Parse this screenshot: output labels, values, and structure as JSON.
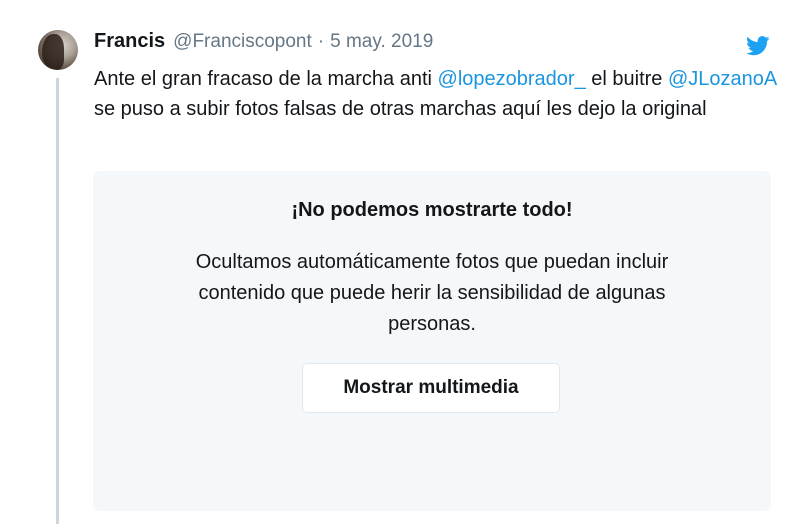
{
  "tweet": {
    "author_name": "Francis",
    "author_handle": "@Franciscopont",
    "separator": "·",
    "date": "5 may. 2019",
    "text_before_mention1": "Ante el gran fracaso de la marcha anti ",
    "mention1": "@lopezobrador_",
    "text_between": " el buitre ",
    "mention2": "@JLozanoA",
    "text_after_mention2": " se puso a subir fotos falsas de otras marchas aquí les dejo la original",
    "brand_icon": "twitter-bird-icon"
  },
  "sensitive_media": {
    "title": "¡No podemos mostrarte todo!",
    "message": "Ocultamos automáticamente fotos que puedan incluir contenido que puede herir la sensibilidad de algunas personas.",
    "button_label": "Mostrar multimedia"
  },
  "colors": {
    "link": "#1b95e0",
    "muted": "#657786",
    "card_background": "#f5f8fa",
    "thread_line": "#ccd6dd"
  }
}
